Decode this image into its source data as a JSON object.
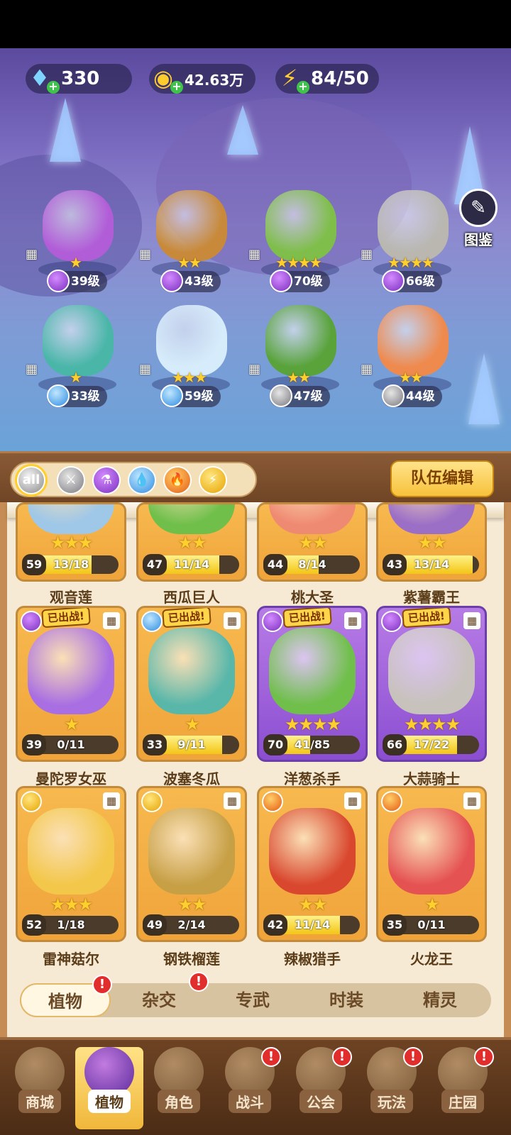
{
  "resources": {
    "gems": "330",
    "coins": "42.63万",
    "energy": "84/50"
  },
  "book_label": "图鉴",
  "formation": [
    {
      "level": "39级",
      "stars": "★",
      "element": "purple",
      "color": "#b25dd8"
    },
    {
      "level": "43级",
      "stars": "★★",
      "element": "purple",
      "color": "#c88a3a"
    },
    {
      "level": "70级",
      "stars": "★★★★",
      "element": "purple",
      "color": "#7fbe4a"
    },
    {
      "level": "66级",
      "stars": "★★★★",
      "element": "purple",
      "color": "#b9b7b0"
    },
    {
      "level": "33级",
      "stars": "★",
      "element": "water",
      "color": "#49b6a8"
    },
    {
      "level": "59级",
      "stars": "★★★",
      "element": "water",
      "color": "#d6ecfb"
    },
    {
      "level": "47级",
      "stars": "★★",
      "element": "sword",
      "color": "#59a33a"
    },
    {
      "level": "44级",
      "stars": "★★",
      "element": "sword",
      "color": "#ef8a4e"
    }
  ],
  "filters": {
    "all_label": "all",
    "team_edit": "队伍编辑"
  },
  "cards_top": [
    {
      "name": "观音莲",
      "level": "59",
      "progress": "13/18",
      "stars": "★★★",
      "fraction": 0.72
    },
    {
      "name": "西瓜巨人",
      "level": "47",
      "progress": "11/14",
      "stars": "★★",
      "fraction": 0.79
    },
    {
      "name": "桃大圣",
      "level": "44",
      "progress": "8/14",
      "stars": "★★",
      "fraction": 0.57
    },
    {
      "name": "紫薯霸王",
      "level": "43",
      "progress": "13/14",
      "stars": "★★",
      "fraction": 0.93
    }
  ],
  "cards_mid": [
    {
      "name": "曼陀罗女巫",
      "level": "39",
      "progress": "0/11",
      "stars": "★",
      "deployed": "已出战!",
      "fraction": 0,
      "element": "purple"
    },
    {
      "name": "波塞冬瓜",
      "level": "33",
      "progress": "9/11",
      "stars": "★",
      "deployed": "已出战!",
      "fraction": 0.82,
      "element": "water"
    },
    {
      "name": "洋葱杀手",
      "level": "70",
      "progress": "41/85",
      "stars": "★★★★",
      "deployed": "已出战!",
      "fraction": 0.48,
      "element": "purple"
    },
    {
      "name": "大蒜骑士",
      "level": "66",
      "progress": "17/22",
      "stars": "★★★★",
      "deployed": "已出战!",
      "fraction": 0.77,
      "element": "purple"
    }
  ],
  "cards_bottom": [
    {
      "name": "雷神菇尔",
      "level": "52",
      "progress": "1/18",
      "stars": "★★★",
      "fraction": 0.06,
      "element": "bolt"
    },
    {
      "name": "钢铁榴莲",
      "level": "49",
      "progress": "2/14",
      "stars": "★★",
      "fraction": 0.14,
      "element": "bolt"
    },
    {
      "name": "辣椒猎手",
      "level": "42",
      "progress": "11/14",
      "stars": "★★",
      "fraction": 0.79,
      "element": "fire"
    },
    {
      "name": "火龙王",
      "level": "35",
      "progress": "0/11",
      "stars": "★",
      "fraction": 0,
      "element": "fire"
    }
  ],
  "subtabs": [
    "植物",
    "杂交",
    "专武",
    "时装",
    "精灵"
  ],
  "nav": [
    "商城",
    "植物",
    "角色",
    "战斗",
    "公会",
    "玩法",
    "庄园"
  ],
  "badge": "!"
}
